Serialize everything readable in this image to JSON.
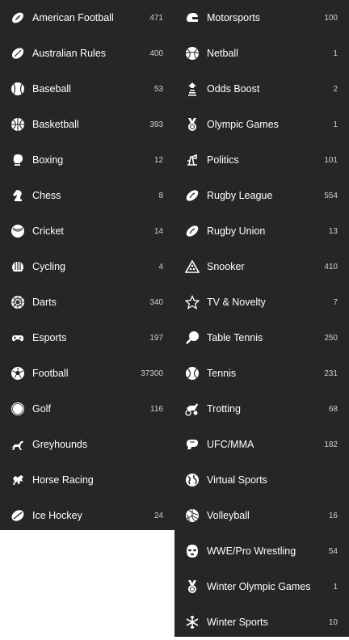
{
  "left_column": [
    {
      "label": "American Football",
      "count": "471",
      "icon": "american-football-icon"
    },
    {
      "label": "Australian Rules",
      "count": "400",
      "icon": "australian-rules-icon"
    },
    {
      "label": "Baseball",
      "count": "53",
      "icon": "baseball-icon"
    },
    {
      "label": "Basketball",
      "count": "393",
      "icon": "basketball-icon"
    },
    {
      "label": "Boxing",
      "count": "12",
      "icon": "boxing-glove-icon"
    },
    {
      "label": "Chess",
      "count": "8",
      "icon": "chess-knight-icon"
    },
    {
      "label": "Cricket",
      "count": "14",
      "icon": "cricket-ball-icon"
    },
    {
      "label": "Cycling",
      "count": "4",
      "icon": "cycling-helmet-icon"
    },
    {
      "label": "Darts",
      "count": "340",
      "icon": "dartboard-icon"
    },
    {
      "label": "Esports",
      "count": "197",
      "icon": "gamepad-icon"
    },
    {
      "label": "Football",
      "count": "37300",
      "icon": "soccer-ball-icon"
    },
    {
      "label": "Golf",
      "count": "116",
      "icon": "golf-ball-icon"
    },
    {
      "label": "Greyhounds",
      "count": "",
      "icon": "greyhound-icon"
    },
    {
      "label": "Horse Racing",
      "count": "",
      "icon": "horse-icon"
    },
    {
      "label": "Ice Hockey",
      "count": "24",
      "icon": "hockey-puck-icon"
    }
  ],
  "right_column": [
    {
      "label": "Motorsports",
      "count": "100",
      "icon": "racing-helmet-icon"
    },
    {
      "label": "Netball",
      "count": "1",
      "icon": "netball-icon"
    },
    {
      "label": "Odds Boost",
      "count": "2",
      "icon": "odds-boost-icon"
    },
    {
      "label": "Olympic Games",
      "count": "1",
      "icon": "medal-icon"
    },
    {
      "label": "Politics",
      "count": "101",
      "icon": "podium-icon"
    },
    {
      "label": "Rugby League",
      "count": "554",
      "icon": "rugby-ball-icon"
    },
    {
      "label": "Rugby Union",
      "count": "13",
      "icon": "rugby-ball-icon"
    },
    {
      "label": "Snooker",
      "count": "410",
      "icon": "snooker-rack-icon"
    },
    {
      "label": "TV & Novelty",
      "count": "7",
      "icon": "star-icon"
    },
    {
      "label": "Table Tennis",
      "count": "250",
      "icon": "table-tennis-paddle-icon"
    },
    {
      "label": "Tennis",
      "count": "231",
      "icon": "tennis-ball-icon"
    },
    {
      "label": "Trotting",
      "count": "68",
      "icon": "trotting-icon"
    },
    {
      "label": "UFC/MMA",
      "count": "182",
      "icon": "mma-glove-icon"
    },
    {
      "label": "Virtual Sports",
      "count": "",
      "icon": "globe-icon"
    },
    {
      "label": "Volleyball",
      "count": "16",
      "icon": "volleyball-icon"
    },
    {
      "label": "WWE/Pro Wrestling",
      "count": "54",
      "icon": "wrestling-mask-icon"
    },
    {
      "label": "Winter Olympic Games",
      "count": "1",
      "icon": "medal-icon"
    },
    {
      "label": "Winter Sports",
      "count": "10",
      "icon": "snowflake-icon"
    }
  ],
  "colors": {
    "background": "#262626",
    "text": "#ffffff",
    "count": "#cfcfcf",
    "page": "#ffffff"
  }
}
